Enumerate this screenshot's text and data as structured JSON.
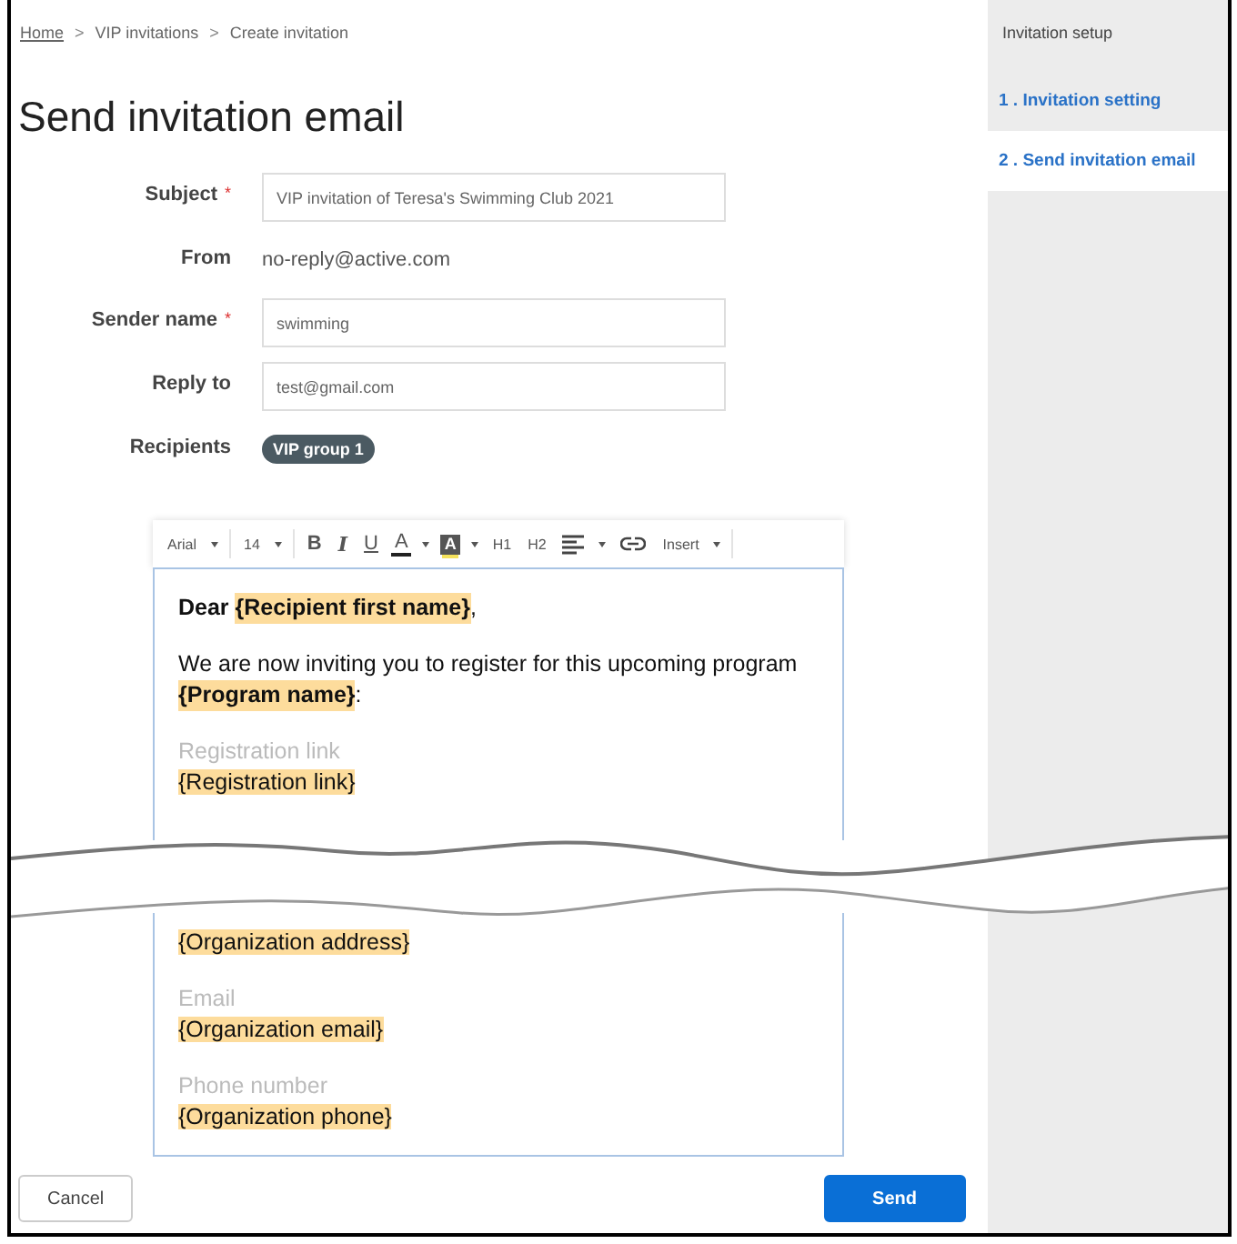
{
  "breadcrumb": [
    {
      "label": "Home",
      "link": true
    },
    {
      "label": "VIP invitations",
      "link": false
    },
    {
      "label": "Create invitation",
      "link": false
    }
  ],
  "breadcrumb_separator": ">",
  "title": "Send invitation email",
  "form": [
    {
      "kind": "input",
      "label": "Subject",
      "required_mark": "*",
      "value": "VIP invitation of Teresa's Swimming Club 2021"
    },
    {
      "kind": "text",
      "label": "From",
      "value": "no-reply@active.com"
    },
    {
      "kind": "input",
      "label": "Sender name",
      "required_mark": "*",
      "value": "swimming"
    },
    {
      "kind": "input",
      "label": "Reply to",
      "value": "test@gmail.com"
    },
    {
      "kind": "chip",
      "label": "Recipients",
      "value": "VIP group 1"
    }
  ],
  "toolbar": [
    {
      "kind": "text",
      "label": "Arial",
      "caret": true
    },
    {
      "kind": "text",
      "label": "14",
      "caret": true
    },
    {
      "kind": "bold",
      "label": "B",
      "caret": false
    },
    {
      "kind": "italic",
      "label": "I",
      "caret": false
    },
    {
      "kind": "underline",
      "label": "U",
      "caret": false
    },
    {
      "kind": "color",
      "label": "A",
      "caret": true
    },
    {
      "kind": "highlight",
      "label": "A",
      "caret": true
    },
    {
      "kind": "text",
      "label": "H1",
      "caret": false
    },
    {
      "kind": "text",
      "label": "H2",
      "caret": false
    },
    {
      "kind": "align",
      "caret": true
    },
    {
      "kind": "link",
      "caret": false
    },
    {
      "kind": "text",
      "label": "Insert",
      "caret": true
    }
  ],
  "editor_top": [
    {
      "kind": "paragraph",
      "segments": [
        {
          "text": "Dear ",
          "bold": true,
          "tag": false
        },
        {
          "text": "{Recipient first name}",
          "bold": true,
          "tag": true
        },
        {
          "text": ",",
          "bold": false,
          "tag": false
        }
      ]
    },
    {
      "kind": "paragraph",
      "segments": [
        {
          "text": "We are now inviting you to register for this upcoming program ",
          "bold": false,
          "tag": false
        },
        {
          "text": "{Program name}",
          "bold": true,
          "tag": true
        },
        {
          "text": ":",
          "bold": false,
          "tag": false
        }
      ]
    },
    {
      "kind": "field",
      "label": "Registration link",
      "token": "{Registration link}"
    }
  ],
  "editor_bottom": [
    {
      "kind": "field",
      "token": "{Organization address}"
    },
    {
      "kind": "field",
      "label": "Email",
      "token": "{Organization email}"
    },
    {
      "kind": "field",
      "label": "Phone number",
      "token": "{Organization phone}"
    }
  ],
  "buttons": [
    {
      "label": "Cancel",
      "primary": false
    },
    {
      "label": "Send",
      "primary": true
    }
  ],
  "sidebar": {
    "header": "Invitation setup",
    "steps": [
      {
        "label": "1 . Invitation setting",
        "selected": false
      },
      {
        "label": "2 . Send invitation email",
        "selected": true
      }
    ]
  }
}
